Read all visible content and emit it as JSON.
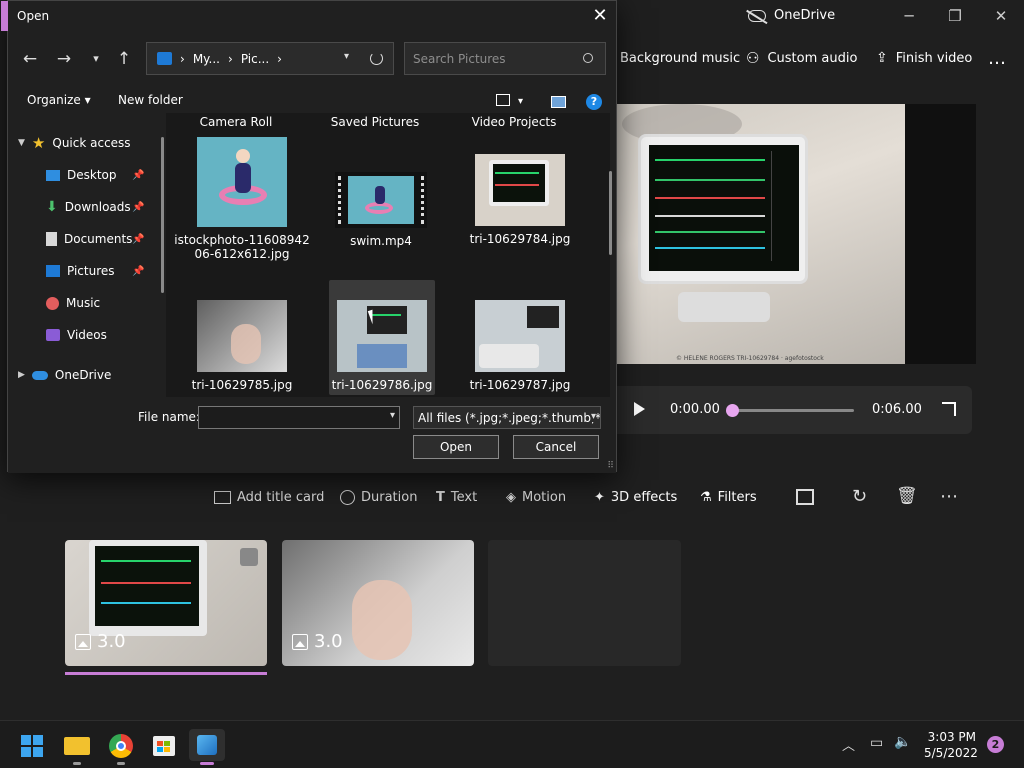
{
  "app": {
    "title": "OneDrive",
    "toolbar": {
      "background_music": "Background music",
      "custom_audio": "Custom audio",
      "finish_video": "Finish video",
      "more": "…"
    },
    "preview_caption": "© HELENE ROGERS\nTRI-10629784 · agefotostock",
    "player": {
      "current_time": "0:00.00",
      "total_time": "0:06.00",
      "progress": 0.0
    },
    "edit_toolbar": {
      "add_title_card": "Add title card",
      "duration": "Duration",
      "text": "Text",
      "motion": "Motion",
      "effects_3d": "3D effects",
      "filters": "Filters"
    },
    "storyboard": [
      {
        "duration": "3.0"
      },
      {
        "duration": "3.0"
      }
    ]
  },
  "dialog": {
    "title": "Open",
    "breadcrumb": [
      "My...",
      "Pic..."
    ],
    "search_placeholder": "Search Pictures",
    "organize": "Organize",
    "new_folder": "New folder",
    "nav": {
      "quick_access": "Quick access",
      "items": [
        "Desktop",
        "Downloads",
        "Documents",
        "Pictures",
        "Music",
        "Videos"
      ],
      "onedrive": "OneDrive"
    },
    "folders": [
      "Camera Roll",
      "Saved Pictures",
      "Video Projects"
    ],
    "files": [
      "istockphoto-1160894206-612x612.jpg",
      "swim.mp4",
      "tri-10629784.jpg",
      "tri-10629785.jpg",
      "tri-10629786.jpg",
      "tri-10629787.jpg"
    ],
    "file_name_label": "File name:",
    "file_name_value": "",
    "file_type": "All files (*.jpg;*.jpeg;*.thumb;*.p",
    "open_button": "Open",
    "cancel_button": "Cancel"
  },
  "taskbar": {
    "time": "3:03 PM",
    "date": "5/5/2022",
    "notifications": "2"
  }
}
